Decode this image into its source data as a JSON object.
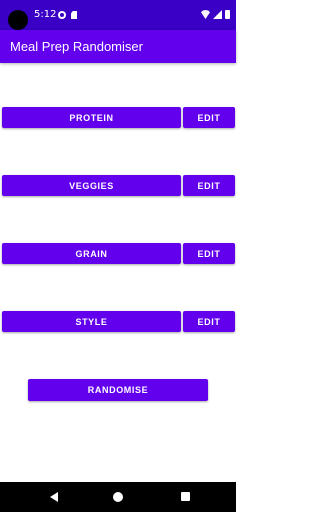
{
  "status_bar": {
    "time": "5:12",
    "icons": [
      "camera-cutout",
      "notification-icon",
      "sd-card-icon",
      "wifi-icon",
      "signal-icon",
      "battery-icon"
    ]
  },
  "app_bar": {
    "title": "Meal Prep Randomiser"
  },
  "categories": [
    {
      "label": "PROTEIN",
      "edit_label": "EDIT"
    },
    {
      "label": "VEGGIES",
      "edit_label": "EDIT"
    },
    {
      "label": "GRAIN",
      "edit_label": "EDIT"
    },
    {
      "label": "STYLE",
      "edit_label": "EDIT"
    }
  ],
  "randomise_label": "RANDOMISE",
  "nav_bar": {
    "icons": [
      "back-icon",
      "home-icon",
      "recents-icon"
    ]
  },
  "colors": {
    "status_bar": "#3a00c5",
    "app_bar": "#6200ee",
    "button": "#6200ee",
    "button_text": "#ffffff",
    "nav_bar": "#000000"
  }
}
